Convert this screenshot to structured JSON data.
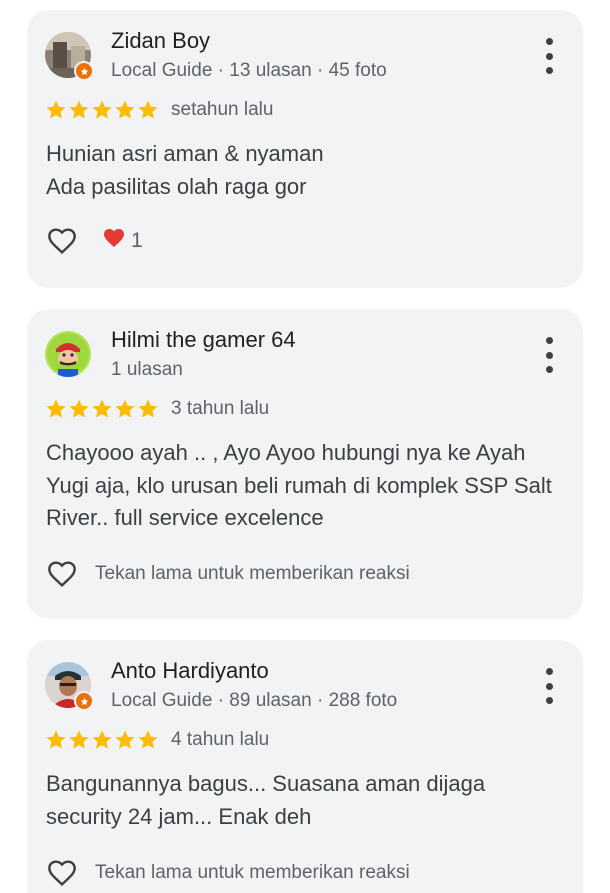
{
  "reviews": [
    {
      "author": "Zidan Boy",
      "meta": "Local Guide · 13 ulasan · 45 foto",
      "local_guide": true,
      "rating": 5,
      "time_ago": "setahun lalu",
      "text_lines": [
        "Hunian asri aman & nyaman",
        "Ada pasilitas olah raga gor"
      ],
      "reaction_emoji": "❤️",
      "reaction_count": "1",
      "avatar_icon": "photo-avatar-room"
    },
    {
      "author": "Hilmi the gamer 64",
      "meta": "1 ulasan",
      "local_guide": false,
      "rating": 5,
      "time_ago": "3 tahun lalu",
      "text_lines": [
        "Chayooo ayah .. , Ayo Ayoo hubungi nya ke Ayah",
        "Yugi aja, klo urusan beli rumah di komplek SSP Salt",
        "River.. full service excelence"
      ],
      "reaction_hint": "Tekan lama untuk memberikan reaksi",
      "avatar_icon": "photo-avatar-mario"
    },
    {
      "author": "Anto Hardiyanto",
      "meta": "Local Guide · 89 ulasan · 288 foto",
      "local_guide": true,
      "rating": 5,
      "time_ago": "4 tahun lalu",
      "text_lines": [
        "Bangunannya bagus... Suasana aman dijaga",
        "security 24 jam... Enak deh"
      ],
      "reaction_hint": "Tekan lama untuk memberikan reaksi",
      "avatar_icon": "photo-avatar-person"
    }
  ],
  "colors": {
    "card_bg": "#f1f3f4",
    "star": "#fbbc04",
    "guide_badge": "#e8710a",
    "heart_red": "#e53935",
    "secondary_text": "#5f6368"
  }
}
